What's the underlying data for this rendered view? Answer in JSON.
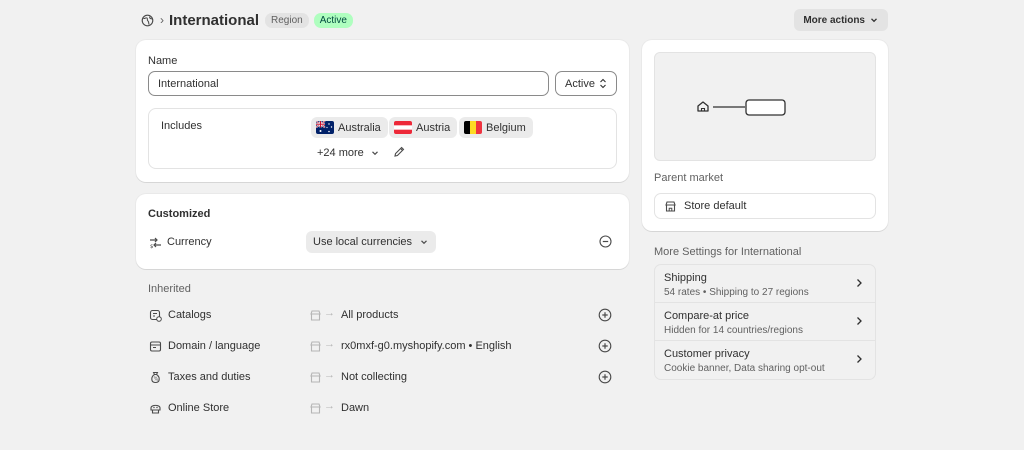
{
  "header": {
    "title": "International",
    "badge_type": "Region",
    "badge_status": "Active",
    "more_actions_label": "More actions"
  },
  "name_card": {
    "name_label": "Name",
    "name_value": "International",
    "status_value": "Active",
    "includes_label": "Includes",
    "countries": [
      {
        "label": "Australia",
        "flag": "australia-flag"
      },
      {
        "label": "Austria",
        "flag": "austria-flag"
      },
      {
        "label": "Belgium",
        "flag": "belgium-flag"
      }
    ],
    "more_label": "+24 more"
  },
  "customized": {
    "title": "Customized",
    "currency_label": "Currency",
    "currency_value": "Use local currencies"
  },
  "inherited": {
    "title": "Inherited",
    "rows": [
      {
        "name": "Catalogs",
        "value": "All products",
        "icon": "catalog-icon",
        "has_add": true
      },
      {
        "name": "Domain / language",
        "value": "rx0mxf-g0.myshopify.com • English",
        "icon": "domain-icon",
        "has_add": true
      },
      {
        "name": "Taxes and duties",
        "value": "Not collecting",
        "icon": "tax-icon",
        "has_add": true
      },
      {
        "name": "Online Store",
        "value": "Dawn",
        "icon": "online-store-icon",
        "has_add": false
      }
    ]
  },
  "parent_market": {
    "label": "Parent market",
    "value": "Store default"
  },
  "more_settings": {
    "title": "More Settings for International",
    "items": [
      {
        "title": "Shipping",
        "subtitle": "54 rates • Shipping to 27 regions"
      },
      {
        "title": "Compare-at price",
        "subtitle": "Hidden for 14 countries/regions"
      },
      {
        "title": "Customer privacy",
        "subtitle": "Cookie banner, Data sharing opt-out"
      }
    ]
  },
  "colors": {
    "page_bg": "#f1f1f1",
    "card_bg": "#ffffff",
    "active_badge_bg": "#affebf",
    "active_badge_text": "#014b40"
  }
}
